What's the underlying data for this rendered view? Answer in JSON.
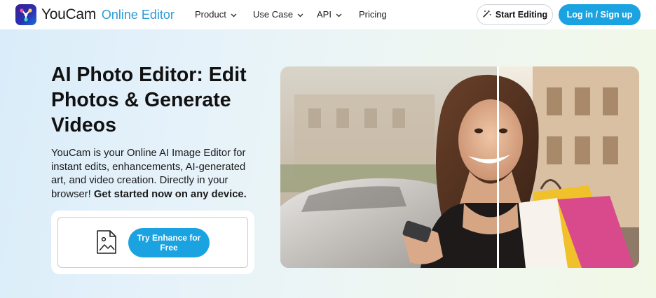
{
  "header": {
    "brand": "YouCam",
    "product": "Online Editor",
    "nav": [
      {
        "label": "Product",
        "has_dropdown": true
      },
      {
        "label": "Use Case",
        "has_dropdown": true
      },
      {
        "label": "API",
        "has_dropdown": true
      },
      {
        "label": "Pricing",
        "has_dropdown": false
      }
    ],
    "start_editing": "Start Editing",
    "login": "Log in / Sign up"
  },
  "hero": {
    "title": "AI Photo Editor: Edit Photos & Generate Videos",
    "description": "YouCam is your Online AI Image Editor for instant edits, enhancements, AI-generated art, and video creation. Directly in your browser!",
    "description_bold": "Get started now on any device.",
    "cta": "Try Enhance for Free",
    "image_icon": "image-upload-icon"
  },
  "colors": {
    "accent": "#1aa3e0",
    "brand_text": "#2a9bd6",
    "logo_gradient_start": "#3b1f8f",
    "logo_gradient_end": "#1d6fd8"
  },
  "icons": {
    "logo": "youcam-logo-icon",
    "start_editing": "magic-wand-icon",
    "dropdown": "chevron-down-icon",
    "upload": "image-upload-icon"
  }
}
